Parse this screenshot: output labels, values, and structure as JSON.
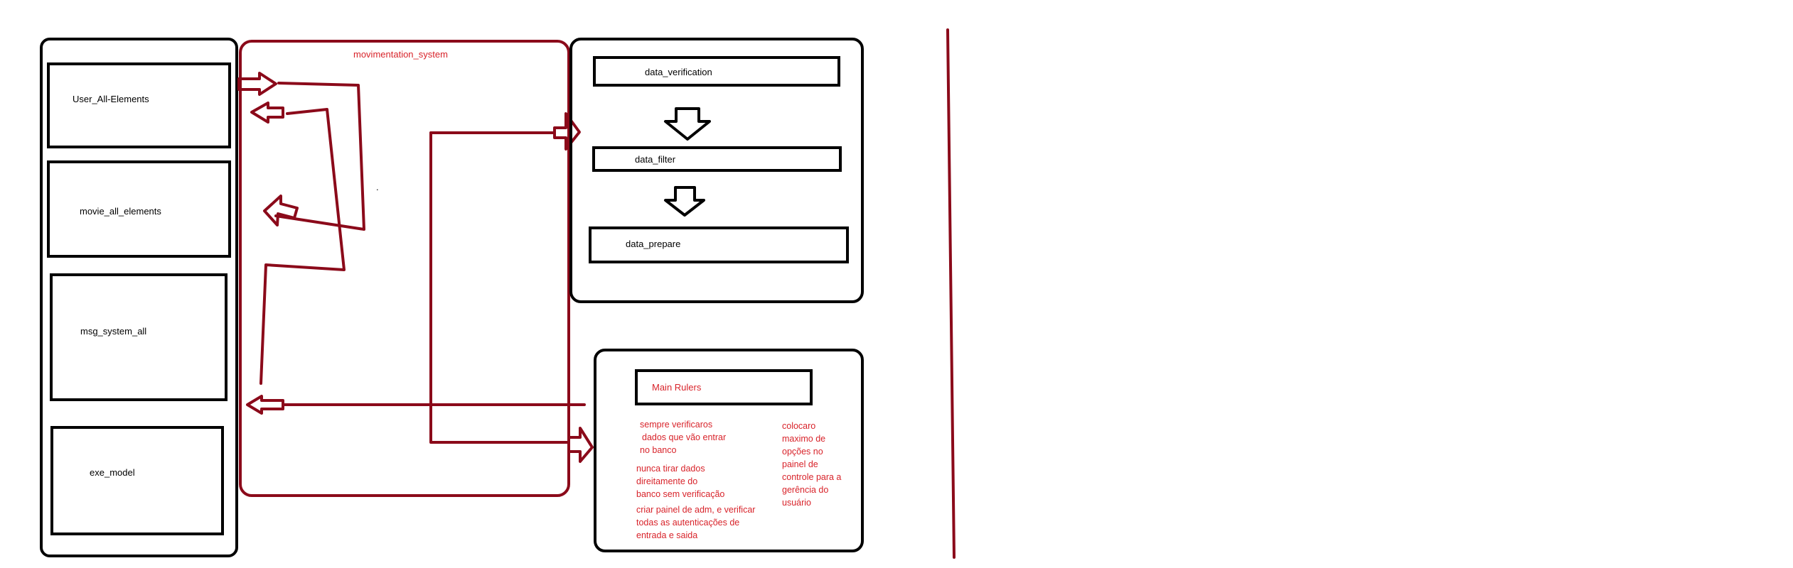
{
  "colors": {
    "black": "#000000",
    "dark_red": "#8b0a1a",
    "red_text": "#d8232a",
    "background": "#ffffff"
  },
  "left_panel": {
    "boxes": [
      {
        "label": "User_All-Elements"
      },
      {
        "label": "movie_all_elements"
      },
      {
        "label": "msg_system_all"
      },
      {
        "label": "exe_model"
      }
    ]
  },
  "movimentation": {
    "title": "movimentation_system"
  },
  "data_panel": {
    "steps": [
      {
        "label": "data_verification"
      },
      {
        "label": "data_filter"
      },
      {
        "label": "data_prepare"
      }
    ]
  },
  "rules_panel": {
    "title": "Main Rulers",
    "note1": [
      "sempre verificaros",
      "dados que vão entrar",
      "no banco"
    ],
    "note2": [
      "nunca tirar dados",
      "direitamente do",
      "banco sem verificação"
    ],
    "note3": [
      "criar painel de adm, e verificar",
      "todas as autenticações de",
      "entrada e saida"
    ],
    "note4": [
      "colocaro",
      "maximo de",
      "opções no",
      "painel de",
      "controle para a",
      "gerência do",
      "usuário"
    ]
  },
  "stray_mark": "."
}
